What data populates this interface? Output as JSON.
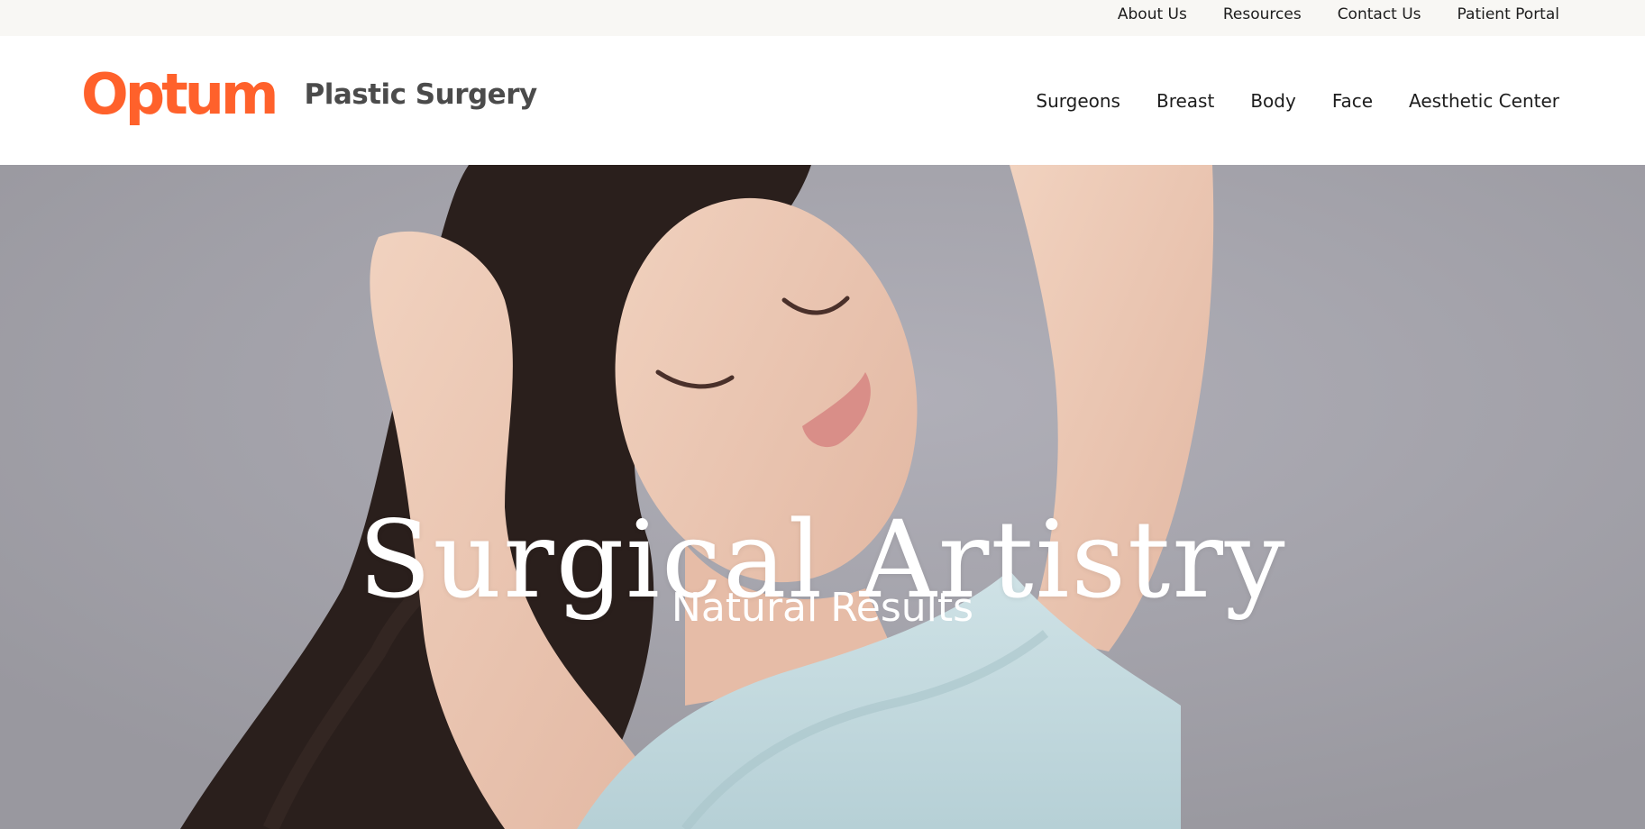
{
  "utility_nav": {
    "items": [
      {
        "label": "About Us"
      },
      {
        "label": "Resources"
      },
      {
        "label": "Contact Us"
      },
      {
        "label": "Patient Portal"
      }
    ]
  },
  "header": {
    "logo_text": "Optum",
    "site_name": "Plastic Surgery"
  },
  "main_nav": {
    "items": [
      {
        "label": "Surgeons"
      },
      {
        "label": "Breast"
      },
      {
        "label": "Body"
      },
      {
        "label": "Face"
      },
      {
        "label": "Aesthetic Center"
      }
    ]
  },
  "hero": {
    "title": "Surgical Artistry",
    "subtitle": "Natural Results",
    "image_subject": "woman-with-raised-arms-photo"
  },
  "colors": {
    "brand_orange": "#ff612b",
    "utility_bar_bg": "#f8f7f4",
    "nav_text": "#1d1d1d",
    "site_name_text": "#4b4b4b",
    "hero_bg": "#a3a2ab"
  }
}
